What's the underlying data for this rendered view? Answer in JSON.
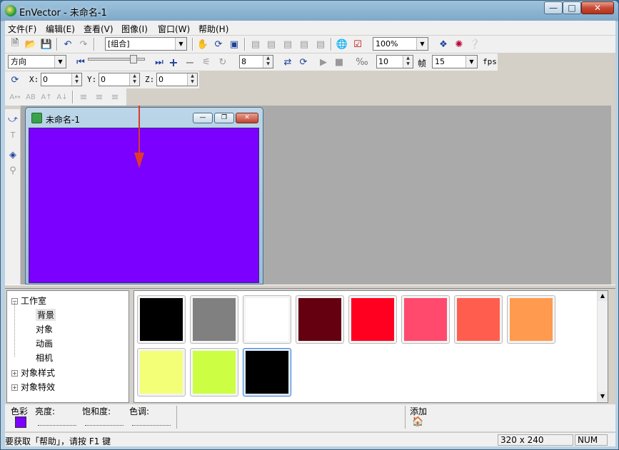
{
  "window": {
    "title": "EnVector - 未命名-1"
  },
  "menu": [
    "文件(F)",
    "编辑(E)",
    "查看(V)",
    "图像(I)",
    "窗口(W)",
    "帮助(H)"
  ],
  "toolbar1": {
    "group_combo": "[组合]",
    "zoom_combo": "100%"
  },
  "toolbar2": {
    "direction_combo": "方向",
    "steps_value": "8",
    "frames_value": "10",
    "frame_label": "帧",
    "fps_value": "15",
    "fps_label": "fps"
  },
  "toolbar3": {
    "x_label": "X:",
    "x_value": "0",
    "y_label": "Y:",
    "y_value": "0",
    "z_label": "Z:",
    "z_value": "0"
  },
  "document": {
    "title": "未命名-1",
    "canvas_color": "#7B00FF"
  },
  "tree": {
    "root": "工作室",
    "children": [
      "背景",
      "对象",
      "动画",
      "相机"
    ],
    "others": [
      "对象样式",
      "对象特效"
    ]
  },
  "swatches": [
    "#000000",
    "#808080",
    "#FFFFFF",
    "#640010",
    "#FF0020",
    "#FF4A6E",
    "#FF5E4E",
    "#FF9A4E",
    "#F4FF78",
    "#CCFF44",
    "#000000"
  ],
  "color_controls": {
    "color_label": "色彩",
    "brightness_label": "亮度:",
    "saturation_label": "饱和度:",
    "hue_label": "色调:",
    "add_label": "添加"
  },
  "status": {
    "help_text": "要获取「帮助」，请按 F1 键",
    "size": "320 x 240",
    "num": "NUM"
  }
}
